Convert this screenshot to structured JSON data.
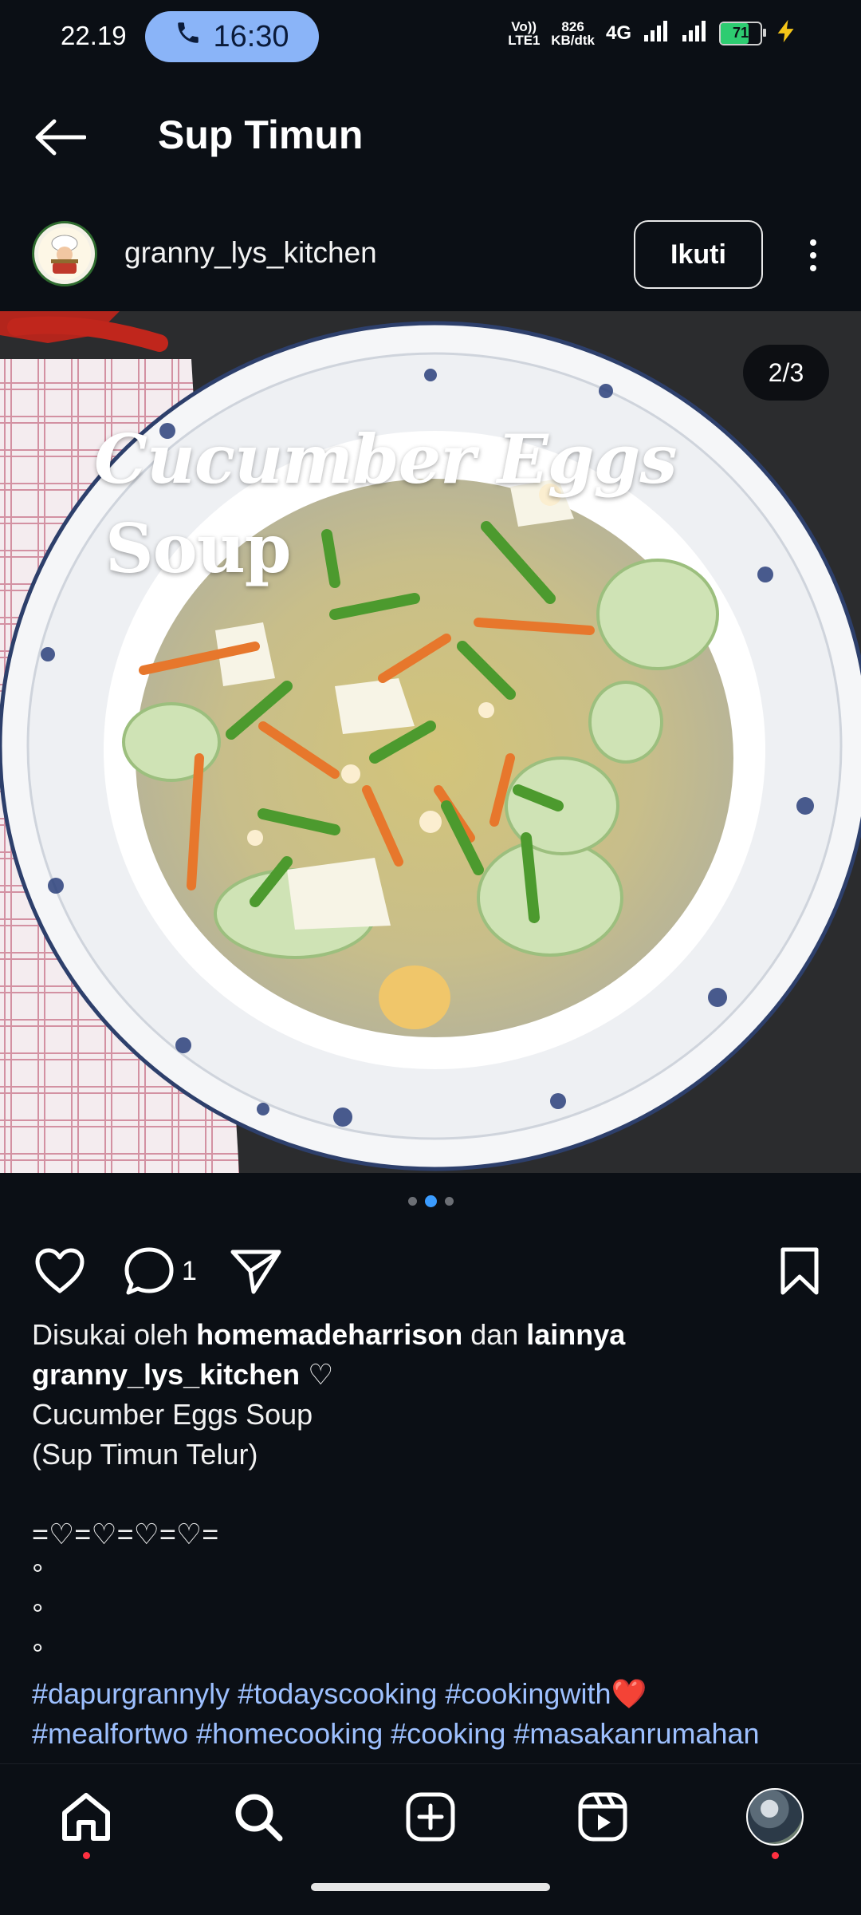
{
  "status_bar": {
    "time": "22.19",
    "call_timer": "16:30",
    "volte": "Vo)) LTE1",
    "speed_value": "826",
    "speed_unit": "KB/dtk",
    "network": "4G",
    "battery": "71"
  },
  "header": {
    "title": "Sup Timun"
  },
  "post": {
    "username": "granny_lys_kitchen",
    "follow_label": "Ikuti",
    "image_counter": "2/3",
    "image_overlay_line1": "Cucumber Eggs",
    "image_overlay_line2": "Soup",
    "comment_count": "1",
    "liked_prefix": "Disukai oleh ",
    "liked_user": "homemadeharrison",
    "liked_mid": " dan ",
    "liked_others": "lainnya",
    "caption_user": "granny_lys_kitchen",
    "caption_symbol": " ♡",
    "caption_lines": [
      "Cucumber Eggs Soup",
      "(Sup Timun Telur)",
      "",
      "=♡=♡=♡=♡=",
      "°",
      "°",
      "°"
    ],
    "hashtags_line1": "#dapurgrannyly #todayscooking #cookingwith",
    "hashtags_line1_emoji": "❤️",
    "hashtags_line2": "#mealfortwo #homecooking #cooking #masakanrumahan"
  },
  "pager": {
    "count": 3,
    "active_index": 1
  },
  "nav": [
    "home-icon",
    "search-icon",
    "create-icon",
    "reels-icon",
    "profile"
  ],
  "colors": {
    "background": "#0b0f15",
    "accent": "#3b9cff",
    "call_pill": "#8ab4f8",
    "hashtag": "#9dc0ff",
    "notification": "#ff3040"
  }
}
